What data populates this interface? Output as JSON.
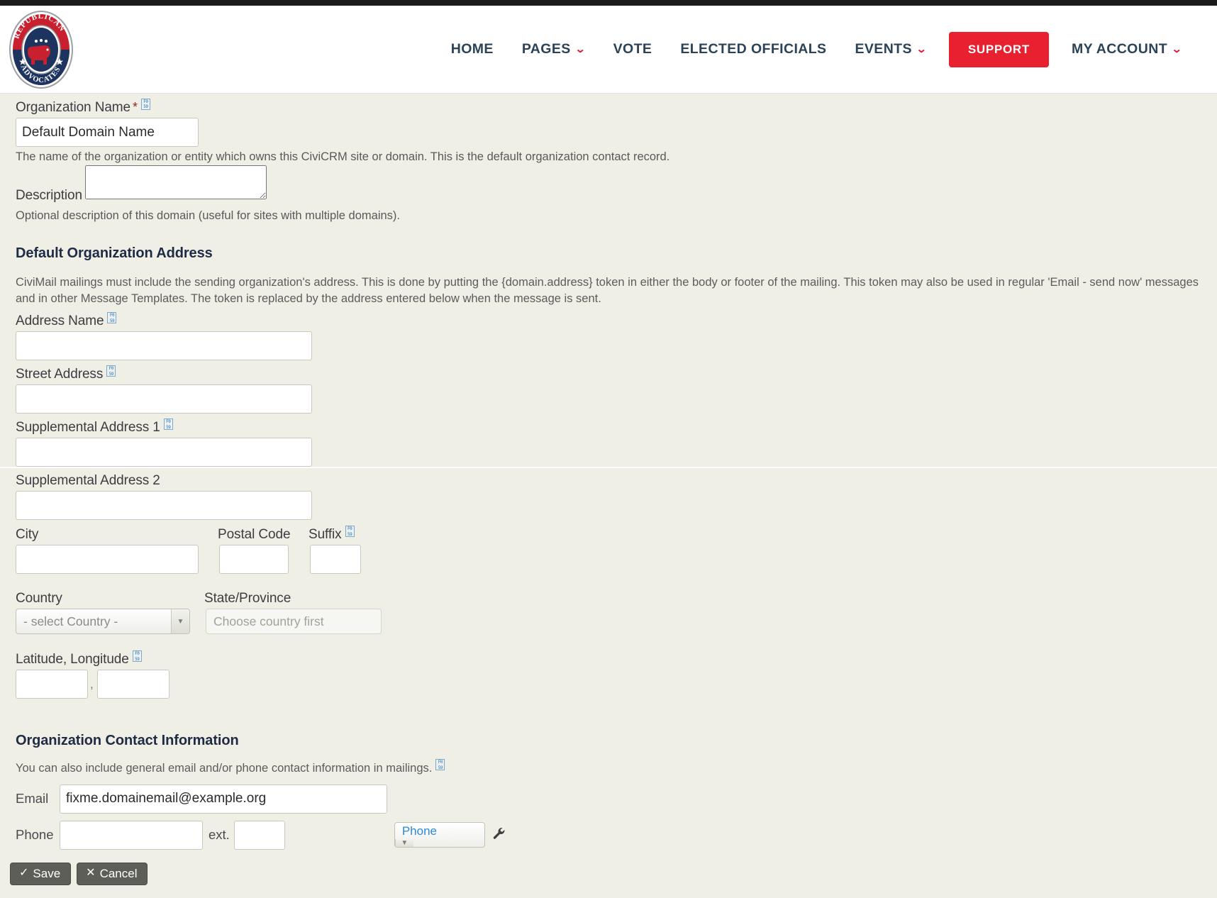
{
  "header": {
    "logo": {
      "icon": "republican-advocates-logo",
      "top_text": "REPUBLICAN",
      "bottom_text": "ADVOCATES"
    },
    "nav": [
      {
        "label": "HOME",
        "has_caret": false
      },
      {
        "label": "PAGES",
        "has_caret": true
      },
      {
        "label": "VOTE",
        "has_caret": false
      },
      {
        "label": "ELECTED OFFICIALS",
        "has_caret": false
      },
      {
        "label": "EVENTS",
        "has_caret": true
      }
    ],
    "support_label": "SUPPORT",
    "account_label": "MY ACCOUNT",
    "caret_glyph": "⌄",
    "accent_red": "#e8202f",
    "nav_text_color": "#2b4257"
  },
  "form": {
    "organization_name": {
      "label": "Organization Name",
      "required_mark": "*",
      "help_icon": "question-circle-icon",
      "help_glyph_top": "F0",
      "help_glyph_bottom": "59",
      "value": "Default Domain Name",
      "note": "The name of the organization or entity which owns this CiviCRM site or domain. This is the default organization contact record."
    },
    "description": {
      "label": "Description",
      "value": "",
      "note": "Optional description of this domain (useful for sites with multiple domains)."
    },
    "address_section": {
      "title": "Default Organization Address",
      "help": "CiviMail mailings must include the sending organization's address. This is done by putting the {domain.address} token in either the body or footer of the mailing. This token may also be used in regular 'Email - send now' messages and in other Message Templates. The token is replaced by the address entered below when the message is sent.",
      "fields": {
        "address_name": {
          "label": "Address Name",
          "value": "",
          "has_help": true
        },
        "street": {
          "label": "Street Address",
          "value": "",
          "has_help": true
        },
        "supplemental1": {
          "label": "Supplemental Address 1",
          "value": "",
          "has_help": true
        },
        "supplemental2": {
          "label": "Supplemental Address 2",
          "value": "",
          "has_help": false
        },
        "city": {
          "label": "City",
          "value": "",
          "has_help": false
        },
        "postal_code": {
          "label": "Postal Code",
          "value": "",
          "has_help": false
        },
        "postal_suffix": {
          "label": "Suffix",
          "value": "",
          "has_help": true
        },
        "country": {
          "label": "Country",
          "value": "- select Country -"
        },
        "state": {
          "label": "State/Province",
          "placeholder": "Choose country first",
          "value": ""
        },
        "geo": {
          "label": "Latitude, Longitude",
          "latitude": "",
          "longitude": "",
          "separator": ",",
          "has_help": true
        }
      }
    },
    "contact_section": {
      "title": "Organization Contact Information",
      "help": "You can also include general email and/or phone contact information in mailings.",
      "email": {
        "label": "Email",
        "value": "fixme.domainemail@example.org"
      },
      "phone": {
        "label": "Phone",
        "value": "",
        "ext_label": "ext.",
        "ext_value": "",
        "type_value": "Phone",
        "wrench_icon": "wrench-icon"
      }
    },
    "buttons": {
      "save": {
        "label": "Save",
        "icon": "check-icon",
        "glyph": "✓"
      },
      "cancel": {
        "label": "Cancel",
        "icon": "close-icon",
        "glyph": "✕"
      }
    }
  }
}
